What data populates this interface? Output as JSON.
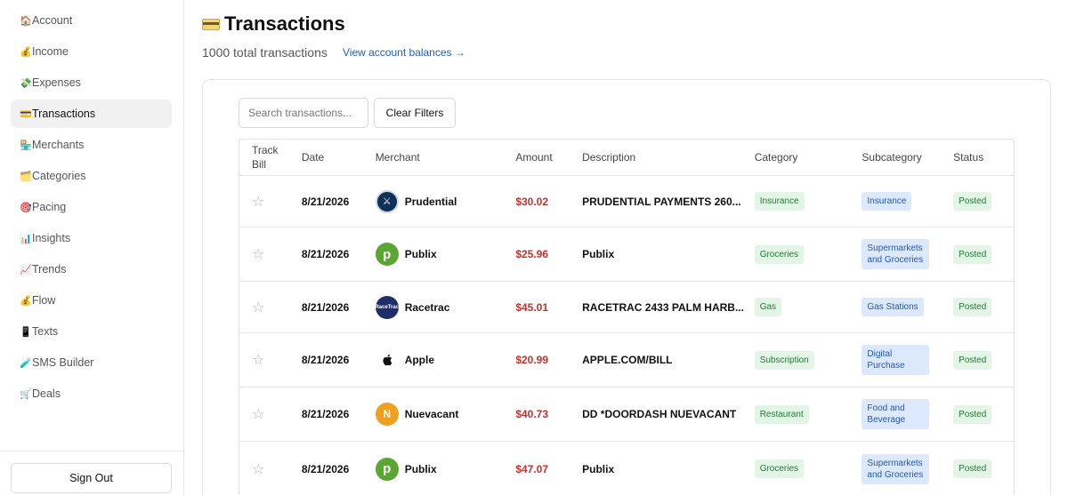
{
  "sidebar": {
    "items": [
      {
        "icon": "🏠",
        "label": "Account"
      },
      {
        "icon": "💰",
        "label": "Income"
      },
      {
        "icon": "💸",
        "label": "Expenses"
      },
      {
        "icon": "💳",
        "label": "Transactions"
      },
      {
        "icon": "🏪",
        "label": "Merchants"
      },
      {
        "icon": "🗂️",
        "label": "Categories"
      },
      {
        "icon": "🎯",
        "label": "Pacing"
      },
      {
        "icon": "📊",
        "label": "Insights"
      },
      {
        "icon": "📈",
        "label": "Trends"
      },
      {
        "icon": "💰",
        "label": "Flow"
      },
      {
        "icon": "📱",
        "label": "Texts"
      },
      {
        "icon": "🧪",
        "label": "SMS Builder"
      },
      {
        "icon": "🛒",
        "label": "Deals"
      }
    ],
    "active_label": "Transactions",
    "sign_out_label": "Sign Out"
  },
  "header": {
    "title": "Transactions",
    "subtitle": "1000 total transactions",
    "link": "View account balances →"
  },
  "toolbar": {
    "search_placeholder": "Search transactions...",
    "clear_label": "Clear Filters"
  },
  "table": {
    "headers": {
      "track_line1": "Track",
      "track_line2": "Bill",
      "date": "Date",
      "merchant": "Merchant",
      "amount": "Amount",
      "description": "Description",
      "category": "Category",
      "subcategory": "Subcategory",
      "status": "Status"
    },
    "rows": [
      {
        "star": "☆",
        "date": "8/21/2026",
        "logo": "pru",
        "logo_text": "⚔",
        "merchant": "Prudential",
        "amount": "$30.02",
        "description": "PRUDENTIAL PAYMENTS 260...",
        "category": "Insurance",
        "subcategory": "Insurance",
        "status": "Posted"
      },
      {
        "star": "☆",
        "date": "8/21/2026",
        "logo": "publix",
        "logo_text": "p",
        "merchant": "Publix",
        "amount": "$25.96",
        "description": "Publix",
        "category": "Groceries",
        "subcategory": "Supermarkets and Groceries",
        "status": "Posted"
      },
      {
        "star": "☆",
        "date": "8/21/2026",
        "logo": "race",
        "logo_text": "RaceTrac",
        "merchant": "Racetrac",
        "amount": "$45.01",
        "description": "RACETRAC 2433 PALM HARB...",
        "category": "Gas",
        "subcategory": "Gas Stations",
        "status": "Posted"
      },
      {
        "star": "☆",
        "date": "8/21/2026",
        "logo": "apple",
        "logo_text": "",
        "merchant": "Apple",
        "amount": "$20.99",
        "description": "APPLE.COM/BILL",
        "category": "Subscription",
        "subcategory": "Digital Purchase",
        "status": "Posted"
      },
      {
        "star": "☆",
        "date": "8/21/2026",
        "logo": "nueva",
        "logo_text": "N",
        "merchant": "Nuevacant",
        "amount": "$40.73",
        "description": "DD *DOORDASH NUEVACANT",
        "category": "Restaurant",
        "subcategory": "Food and Beverage",
        "status": "Posted"
      },
      {
        "star": "☆",
        "date": "8/21/2026",
        "logo": "publix",
        "logo_text": "p",
        "merchant": "Publix",
        "amount": "$47.07",
        "description": "Publix",
        "category": "Groceries",
        "subcategory": "Supermarkets and Groceries",
        "status": "Posted"
      }
    ]
  },
  "colors": {
    "amount": "#c9302c",
    "link": "#1a5fc8",
    "badge_green_bg": "#e3f5e6",
    "badge_blue_bg": "#dce8fb"
  }
}
